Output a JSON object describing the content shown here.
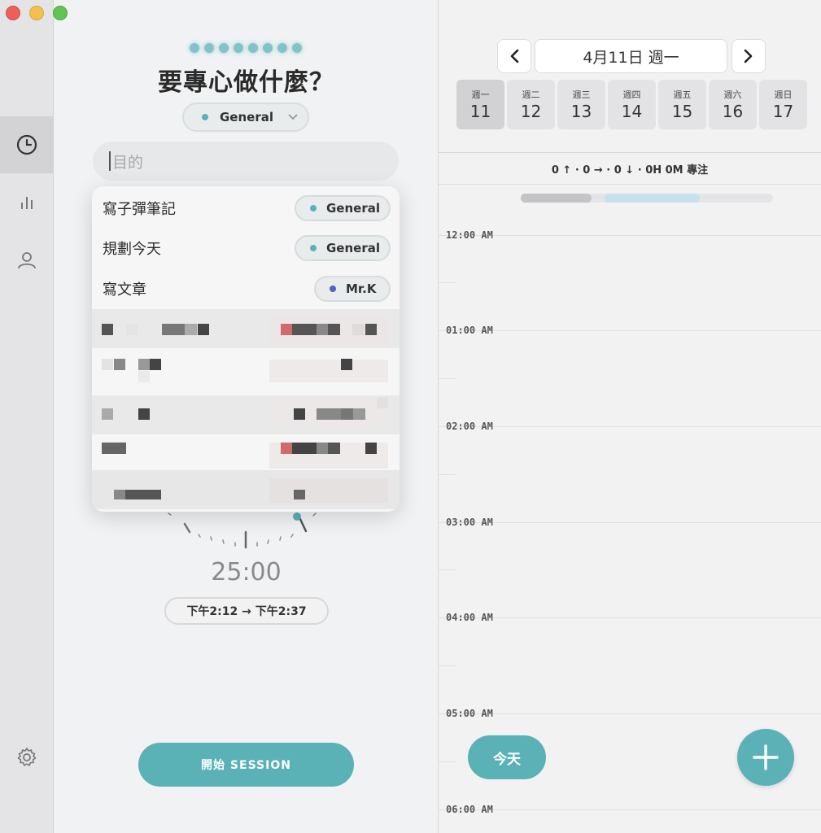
{
  "sidebar": {
    "items": [
      {
        "name": "timer",
        "icon": "clock-icon",
        "active": true
      },
      {
        "name": "stats",
        "icon": "bar-chart-icon",
        "active": false
      },
      {
        "name": "profile",
        "icon": "person-icon",
        "active": false
      }
    ],
    "settings_icon": "gear-icon"
  },
  "left": {
    "heading": "要專心做什麼？",
    "tag_select": {
      "label": "General",
      "color": "#5ab2b8"
    },
    "purpose_placeholder": "目的",
    "dropdown": [
      {
        "label": "寫子彈筆記",
        "tag": "General",
        "tag_color": "#5ab2b8"
      },
      {
        "label": "規劃今天",
        "tag": "General",
        "tag_color": "#5ab2b8"
      },
      {
        "label": "寫文章",
        "tag": "Mr.K",
        "tag_color": "#4c62c4"
      }
    ],
    "timer": "25:00",
    "range": "下午2:12 → 下午2:37",
    "start_button": "開始 SESSION"
  },
  "right": {
    "date_title": "4月11日 週一",
    "days": [
      {
        "name": "週一",
        "num": "11",
        "selected": true
      },
      {
        "name": "週二",
        "num": "12",
        "selected": false
      },
      {
        "name": "週三",
        "num": "13",
        "selected": false
      },
      {
        "name": "週四",
        "num": "14",
        "selected": false
      },
      {
        "name": "週五",
        "num": "15",
        "selected": false
      },
      {
        "name": "週六",
        "num": "16",
        "selected": false
      },
      {
        "name": "週日",
        "num": "17",
        "selected": false
      }
    ],
    "stats": "0 ↑ · 0 → · 0 ↓ · 0H 0M 專注",
    "hours": [
      "12:00 AM",
      "01:00 AM",
      "02:00 AM",
      "03:00 AM",
      "04:00 AM",
      "05:00 AM",
      "06:00 AM"
    ],
    "today_button": "今天"
  },
  "colors": {
    "accent": "#5ab1b6",
    "mrk": "#4c62c4"
  }
}
